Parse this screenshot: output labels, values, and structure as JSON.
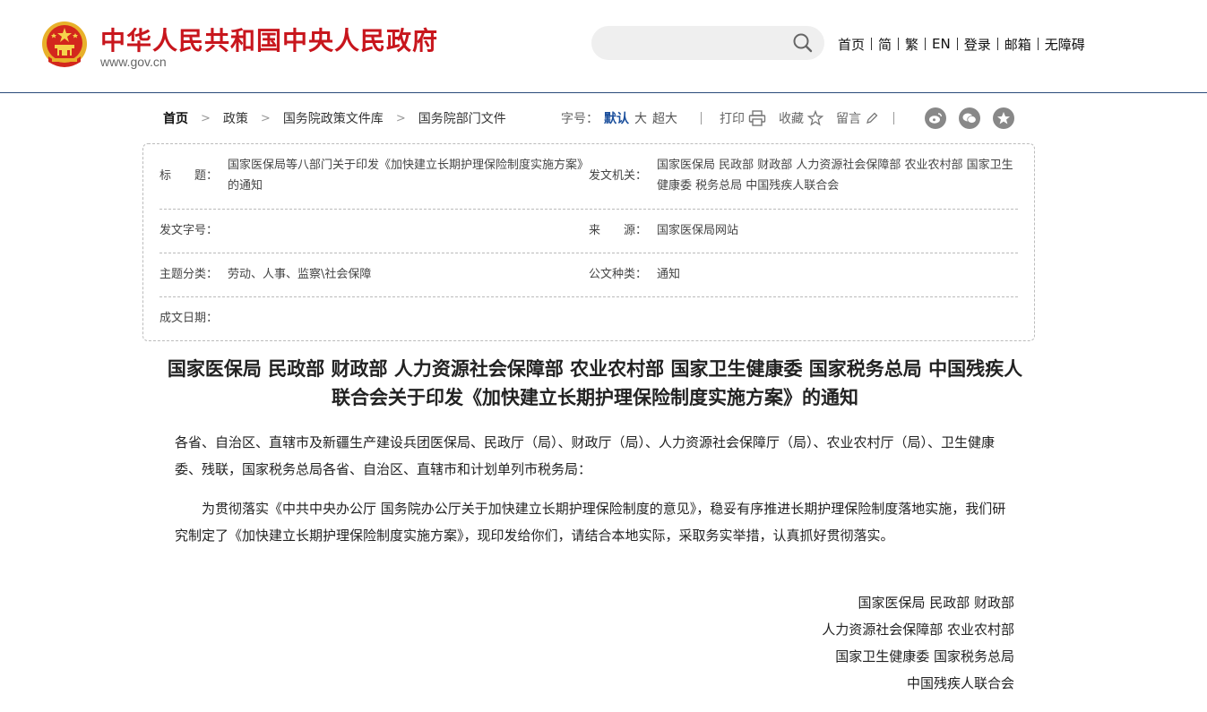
{
  "header": {
    "site_title": "中华人民共和国中央人民政府",
    "site_url": "www.gov.cn",
    "search_placeholder": "",
    "nav": [
      "首页",
      "简",
      "繁",
      "EN",
      "登录",
      "邮箱",
      "无障碍"
    ]
  },
  "breadcrumb": [
    "首页",
    "政策",
    "国务院政策文件库",
    "国务院部门文件"
  ],
  "tools": {
    "font_label": "字号：",
    "sizes": [
      "默认",
      "大",
      "超大"
    ],
    "print": "打印",
    "favorite": "收藏",
    "comment": "留言",
    "share_icons": [
      "weibo-icon",
      "wechat-icon",
      "qzone-icon"
    ]
  },
  "info": {
    "title_label": "标　　题：",
    "title_value": "国家医保局等八部门关于印发《加快建立长期护理保险制度实施方案》的通知",
    "issuer_label": "发文机关：",
    "issuer_value": "国家医保局 民政部 财政部 人力资源社会保障部 农业农村部 国家卫生健康委 税务总局 中国残疾人联合会",
    "doc_no_label": "发文字号：",
    "doc_no_value": "",
    "source_label": "来　　源：",
    "source_value": "国家医保局网站",
    "topic_label": "主题分类：",
    "topic_value": "劳动、人事、监察\\社会保障",
    "type_label": "公文种类：",
    "type_value": "通知",
    "date_label": "成文日期：",
    "date_value": ""
  },
  "article": {
    "title": "国家医保局 民政部 财政部 人力资源社会保障部 农业农村部 国家卫生健康委 国家税务总局 中国残疾人联合会关于印发《加快建立长期护理保险制度实施方案》的通知",
    "recipients": "各省、自治区、直辖市及新疆生产建设兵团医保局、民政厅（局）、财政厅（局）、人力资源社会保障厅（局）、农业农村厅（局）、卫生健康委、残联，国家税务总局各省、自治区、直辖市和计划单列市税务局：",
    "body": "为贯彻落实《中共中央办公厅 国务院办公厅关于加快建立长期护理保险制度的意见》，稳妥有序推进长期护理保险制度落地实施，我们研究制定了《加快建立长期护理保险制度实施方案》，现印发给你们，请结合本地实际，采取务实举措，认真抓好贯彻落实。",
    "signatures": [
      "国家医保局 民政部 财政部",
      "人力资源社会保障部 农业农村部",
      "国家卫生健康委 国家税务总局",
      "中国残疾人联合会"
    ]
  },
  "colors": {
    "brand_red": "#c8161d",
    "link_blue": "#1b4f9c",
    "header_rule": "#2a4a7a"
  }
}
